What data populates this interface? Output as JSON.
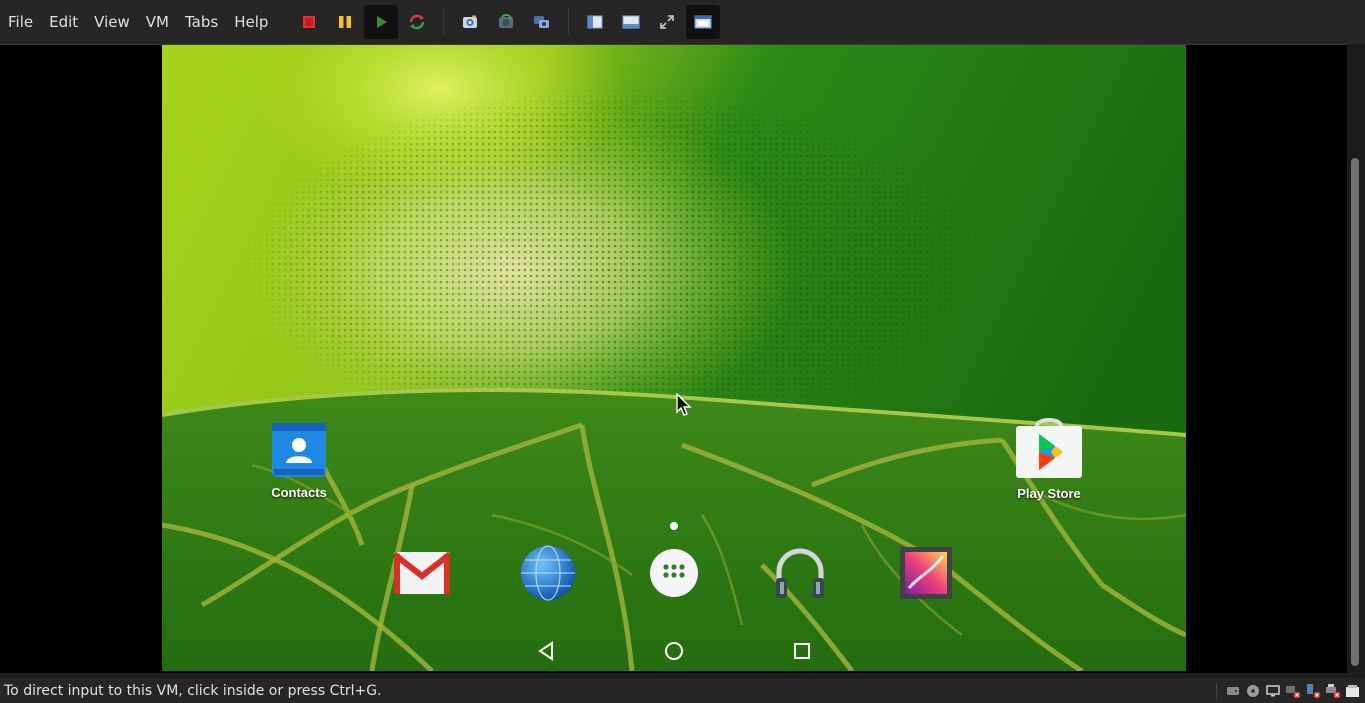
{
  "menubar": {
    "items": [
      "File",
      "Edit",
      "View",
      "VM",
      "Tabs",
      "Help"
    ]
  },
  "toolbar": {
    "buttons": [
      {
        "icon": "power-off-icon"
      },
      {
        "icon": "pause-icon"
      },
      {
        "icon": "play-icon"
      },
      {
        "icon": "reset-icon"
      },
      {
        "icon": "snapshot-icon"
      },
      {
        "icon": "revert-snapshot-icon"
      },
      {
        "icon": "snapshot-manager-icon"
      },
      {
        "icon": "sidebar-icon"
      },
      {
        "icon": "thumbnail-bar-icon"
      },
      {
        "icon": "fullscreen-icon"
      },
      {
        "icon": "console-view-icon",
        "active": true
      }
    ]
  },
  "desktop": {
    "apps": [
      {
        "name": "Contacts",
        "icon": "contacts-icon"
      },
      {
        "name": "Play Store",
        "icon": "play-store-icon"
      }
    ],
    "dock": [
      {
        "icon": "gmail-icon"
      },
      {
        "icon": "browser-globe-icon"
      },
      {
        "icon": "app-drawer-icon"
      },
      {
        "icon": "music-headphones-icon"
      },
      {
        "icon": "gallery-icon"
      }
    ],
    "nav": [
      "back-icon",
      "home-icon",
      "recents-icon"
    ]
  },
  "status": {
    "text": "To direct input to this VM, click inside or press Ctrl+G.",
    "icons": [
      "hard-disk-icon",
      "cd-drive-icon",
      "display-icon",
      "network-disconnected-icon",
      "usb-disconnected-icon",
      "printer-disconnected-icon",
      "message-icon"
    ]
  },
  "colors": {
    "chrome_bg": "#262626",
    "wallpaper_green": "#1f6a12",
    "wallpaper_lime": "#b7e01a"
  }
}
